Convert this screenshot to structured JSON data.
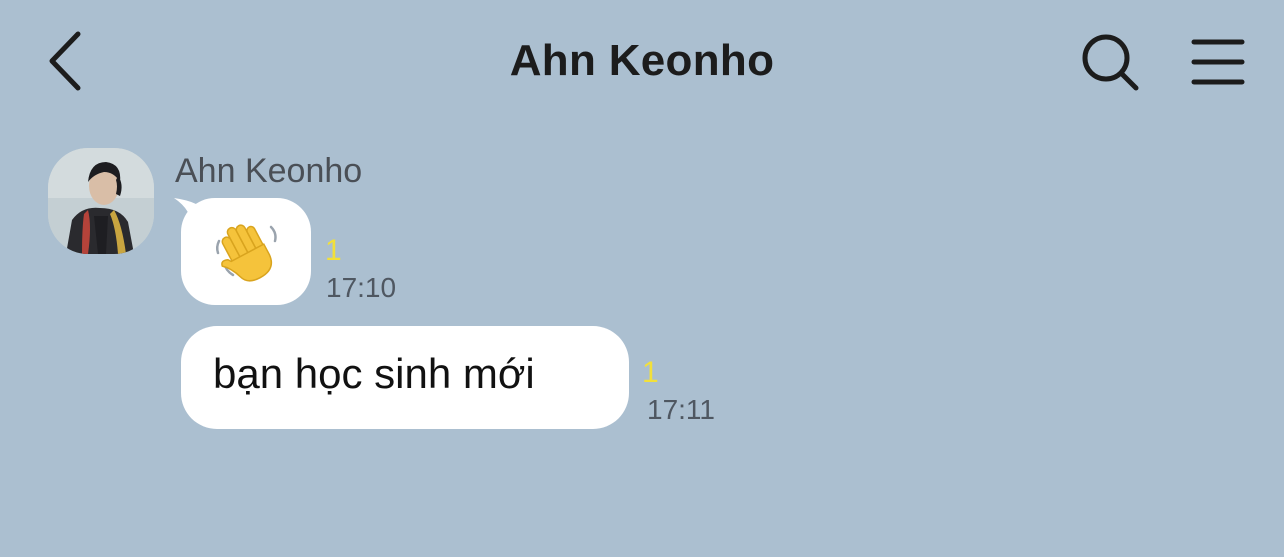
{
  "header": {
    "title": "Ahn Keonho",
    "back_icon": "chevron-left-icon",
    "search_icon": "search-icon",
    "menu_icon": "hamburger-menu-icon"
  },
  "conversation": {
    "sender_name": "Ahn Keonho",
    "messages": [
      {
        "type": "emoji",
        "content": "👋",
        "icon": "waving-hand-icon",
        "unread_count": "1",
        "time": "17:10"
      },
      {
        "type": "text",
        "content": "bạn học sinh mới",
        "unread_count": "1",
        "time": "17:11"
      }
    ]
  },
  "colors": {
    "background": "#abbfd0",
    "bubble": "#ffffff",
    "unread": "#f2e03a",
    "time": "#4f5761"
  }
}
